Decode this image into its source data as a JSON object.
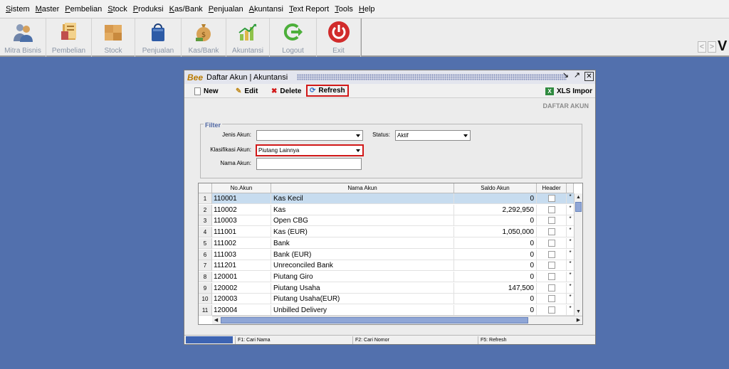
{
  "menubar": {
    "items": [
      "Sistem",
      "Master",
      "Pembelian",
      "Stock",
      "Produksi",
      "Kas/Bank",
      "Penjualan",
      "Akuntansi",
      "Text Report",
      "Tools",
      "Help"
    ]
  },
  "toolbar": {
    "buttons": [
      {
        "label": "Mitra Bisnis",
        "icon": "people-icon"
      },
      {
        "label": "Pembelian",
        "icon": "purchase-book-icon"
      },
      {
        "label": "Stock",
        "icon": "boxes-icon"
      },
      {
        "label": "Penjualan",
        "icon": "shopping-bag-icon"
      },
      {
        "label": "Kas/Bank",
        "icon": "money-bag-icon"
      },
      {
        "label": "Akuntansi",
        "icon": "accounting-chart-icon"
      },
      {
        "label": "Logout",
        "icon": "logout-arrow-icon"
      },
      {
        "label": "Exit",
        "icon": "power-icon"
      }
    ],
    "nav_prev": "<",
    "nav_next": ">",
    "brand_letter": "V"
  },
  "window": {
    "logo": "Bee",
    "title": "Daftar Akun | Akuntansi",
    "buttons": {
      "new": "New",
      "edit": "Edit",
      "delete": "Delete",
      "refresh": "Refresh",
      "xls": "XLS Impor"
    },
    "heading": "DAFTAR AKUN",
    "filter": {
      "legend": "Filter",
      "jenis_label": "Jenis Akun:",
      "jenis_value": "",
      "status_label": "Status:",
      "status_value": "Aktif",
      "klasifikasi_label": "Klasifikasi Akun:",
      "klasifikasi_value": "Piutang Lainnya",
      "nama_label": "Nama Akun:",
      "nama_value": ""
    },
    "table": {
      "columns": {
        "no": "No.Akun",
        "nama": "Nama Akun",
        "saldo": "Saldo Akun",
        "header": "Header"
      },
      "rows": [
        {
          "n": "1",
          "no": "110001",
          "nama": "Kas Kecil",
          "saldo": "0"
        },
        {
          "n": "2",
          "no": "110002",
          "nama": "Kas",
          "saldo": "2,292,950"
        },
        {
          "n": "3",
          "no": "110003",
          "nama": "Open CBG",
          "saldo": "0"
        },
        {
          "n": "4",
          "no": "111001",
          "nama": "Kas (EUR)",
          "saldo": "1,050,000"
        },
        {
          "n": "5",
          "no": "111002",
          "nama": "Bank",
          "saldo": "0"
        },
        {
          "n": "6",
          "no": "111003",
          "nama": "Bank (EUR)",
          "saldo": "0"
        },
        {
          "n": "7",
          "no": "111201",
          "nama": "Unreconciled Bank",
          "saldo": "0"
        },
        {
          "n": "8",
          "no": "120001",
          "nama": "Piutang Giro",
          "saldo": "0"
        },
        {
          "n": "9",
          "no": "120002",
          "nama": "Piutang Usaha",
          "saldo": "147,500"
        },
        {
          "n": "10",
          "no": "120003",
          "nama": "Piutang Usaha(EUR)",
          "saldo": "0"
        },
        {
          "n": "11",
          "no": "120004",
          "nama": "Unbilled Delivery",
          "saldo": "0"
        }
      ],
      "row_mark": "*"
    },
    "status": {
      "f1": "F1: Cari Nama",
      "f2": "F2: Cari Nomor",
      "f5": "F5: Refresh"
    }
  }
}
